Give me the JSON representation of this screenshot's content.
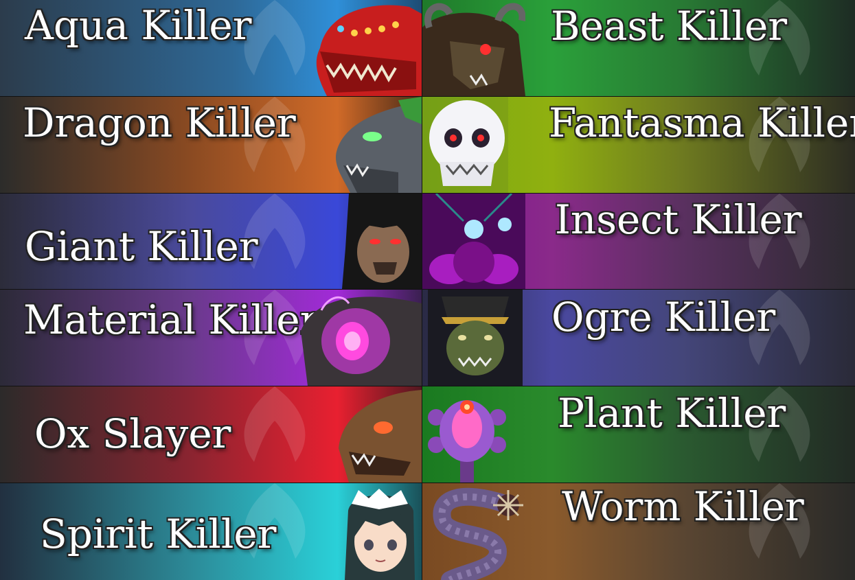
{
  "banners": {
    "aqua": "Aqua Killer",
    "beast": "Beast Killer",
    "dragon": "Dragon Killer",
    "fantasma": "Fantasma Killer",
    "giant": "Giant Killer",
    "insect": "Insect Killer",
    "material": "Material Killer",
    "ogre": "Ogre Killer",
    "ox": "Ox Slayer",
    "plant": "Plant Killer",
    "spirit": "Spirit Killer",
    "worm": "Worm Killer"
  },
  "portraits": {
    "aqua": "red-fish-monster",
    "beast": "horned-goat-beast",
    "dragon": "grey-dragon-head",
    "fantasma": "white-skull",
    "giant": "dark-haired-giant",
    "insect": "purple-moth",
    "material": "pink-glowing-golem",
    "ogre": "green-ogre",
    "ox": "brown-ox-beast",
    "plant": "purple-flower-plant",
    "spirit": "maid-girl",
    "worm": "purple-spiked-worm"
  }
}
